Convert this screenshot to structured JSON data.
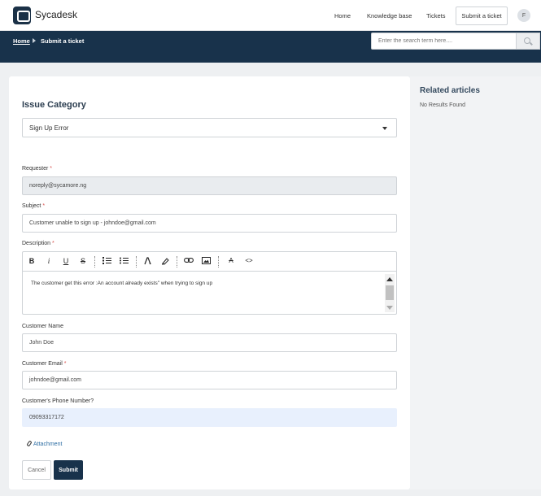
{
  "app": {
    "brand": "Sycadesk"
  },
  "nav": {
    "home": "Home",
    "knowledge_base": "Knowledge base",
    "tickets": "Tickets",
    "submit_ticket": "Submit a ticket",
    "avatar_initial": "F"
  },
  "breadcrumb": {
    "home": "Home",
    "current": "Submit a ticket"
  },
  "search": {
    "placeholder": "Enter the search term here....",
    "icon": "search-icon"
  },
  "form": {
    "issue_category_heading": "Issue Category",
    "issue_category_value": "Sign Up Error",
    "requester_label": "Requester",
    "requester_value": "noreply@sycamore.ng",
    "subject_label": "Subject",
    "subject_value": "Customer unable to sign up - johndoe@gmail.com",
    "description_label": "Description",
    "description_value": "The customer get this error :An account already exists\" when trying to sign up",
    "customer_name_label": "Customer Name",
    "customer_name_value": "John Doe",
    "customer_email_label": "Customer Email",
    "customer_email_value": "johndoe@gmail.com",
    "phone_label": "Customer's Phone Number?",
    "phone_value": "09093317172",
    "required_mark": "*",
    "attachment_label": "Attachment",
    "cancel_label": "Cancel",
    "submit_label": "Submit"
  },
  "editor_toolbar": {
    "bold": "B",
    "italic": "i",
    "underline": "U",
    "strike": "S",
    "clear_format": "A",
    "code": "<>"
  },
  "sidebar": {
    "title": "Related articles",
    "empty": "No Results Found"
  }
}
